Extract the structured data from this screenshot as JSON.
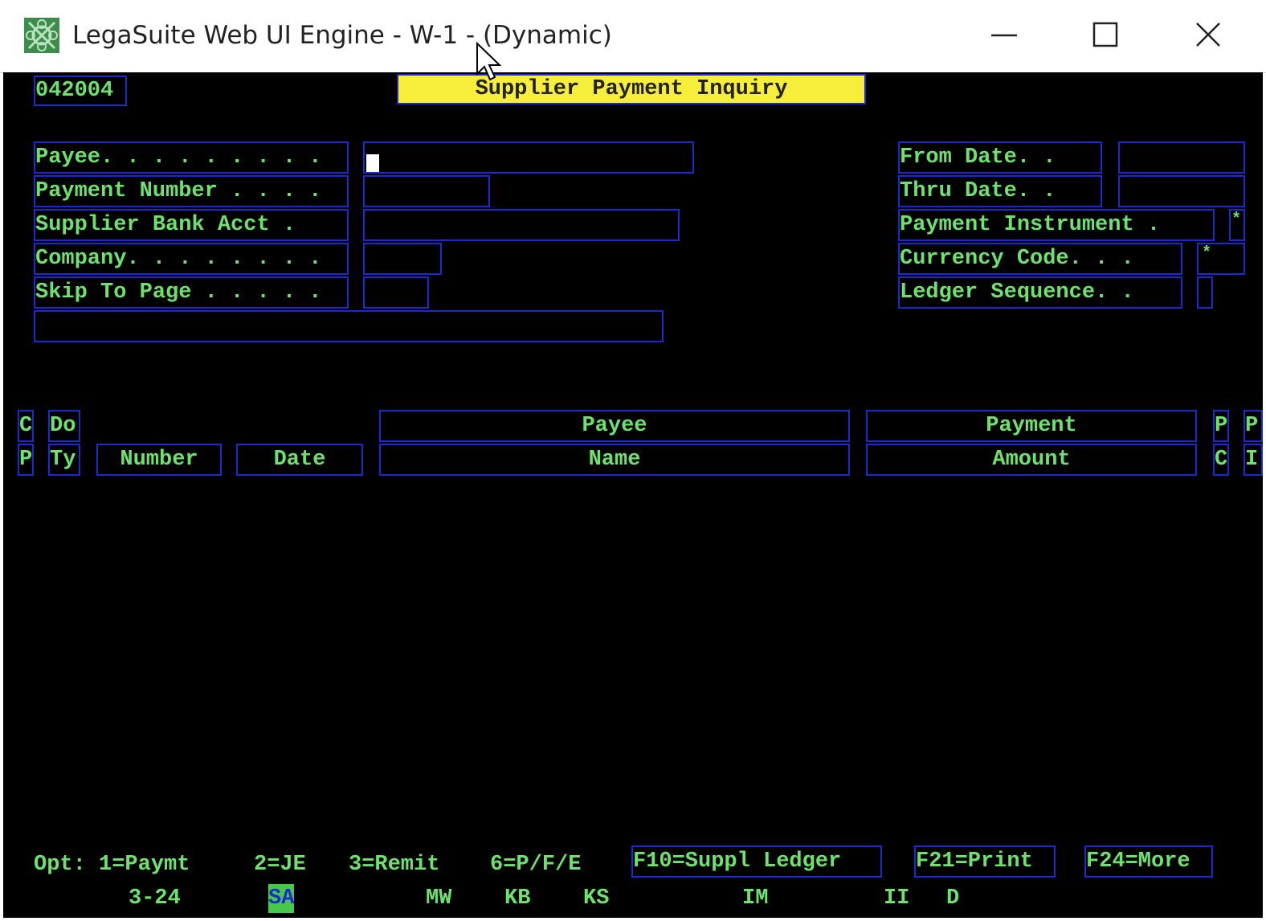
{
  "window": {
    "title": "LegaSuite Web UI Engine - W-1 - (Dynamic)",
    "icons": {
      "app": "legasuite-app-icon",
      "minimize": "minimize-icon",
      "maximize": "maximize-icon",
      "close": "close-icon"
    }
  },
  "screen": {
    "program_id": "042004",
    "title": "Supplier Payment Inquiry",
    "left_fields": [
      {
        "label": "Payee. . . . . . . . .",
        "value": ""
      },
      {
        "label": "Payment Number . . . .",
        "value": ""
      },
      {
        "label": "Supplier Bank Acct .",
        "value": ""
      },
      {
        "label": "Company. . . . . . . .",
        "value": ""
      },
      {
        "label": "Skip To Page . . . . .",
        "value": ""
      }
    ],
    "right_fields": [
      {
        "label": "From Date. .",
        "value": ""
      },
      {
        "label": "Thru Date. .",
        "value": ""
      },
      {
        "label": "Payment Instrument .",
        "value": "*"
      },
      {
        "label": "Currency Code. . .",
        "value": "*"
      },
      {
        "label": "Ledger Sequence. .",
        "value": ""
      }
    ],
    "columns": {
      "c1_top": "C",
      "c1_bot": "P",
      "c2_top": "Do",
      "c2_bot": "Ty",
      "number": "Number",
      "date": "Date",
      "payee_top": "Payee",
      "payee_bot": "Name",
      "payment_top": "Payment",
      "payment_bot": "Amount",
      "p1_top": "P",
      "p1_bot": "C",
      "p2_top": "P",
      "p2_bot": "I"
    },
    "options": {
      "opt": "Opt: 1=Paymt",
      "je": "2=JE",
      "remit": "3=Remit",
      "pfe": "6=P/F/E",
      "f10": "F10=Suppl Ledger",
      "f21": "F21=Print",
      "f24": "F24=More"
    },
    "status": {
      "page": "3-24",
      "sa": "SA",
      "mw": "MW",
      "kb": "KB",
      "ks": "KS",
      "im": "IM",
      "ii": "II",
      "d": "D"
    }
  }
}
